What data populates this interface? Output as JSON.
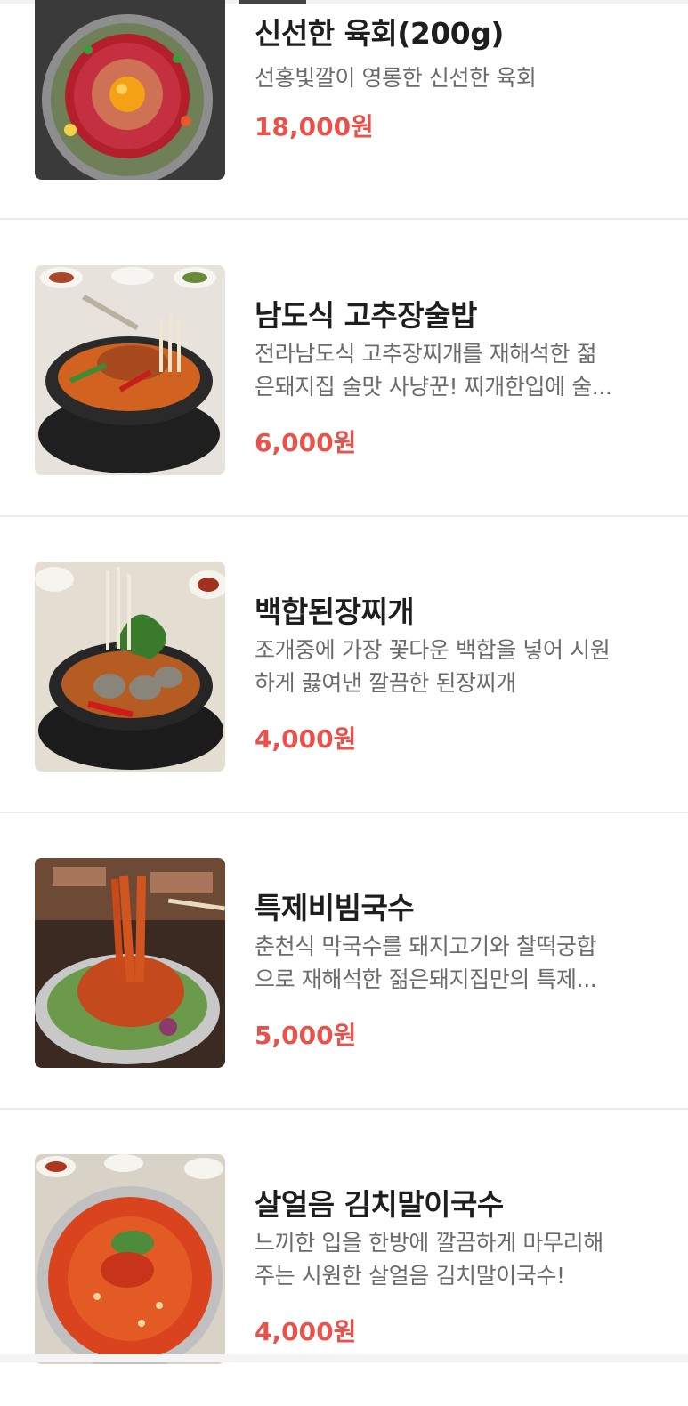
{
  "menu_items": [
    {
      "name": "신선한 육회(200g)",
      "desc_lines": [
        "선홍빛깔이 영롱한 신선한 육회"
      ],
      "price": "18,000원",
      "photo": "yukhoe-photo"
    },
    {
      "name": "남도식 고추장술밥",
      "desc_lines": [
        "전라남도식 고추장찌개를 재해석한 젊",
        "은돼지집 술맛 사냥꾼! 찌개한입에 술..."
      ],
      "price": "6,000원",
      "photo": "gochujang-stew-photo"
    },
    {
      "name": "백합된장찌개",
      "desc_lines": [
        "조개중에 가장 꽃다운 백합을 넣어 시원",
        "하게 끓여낸 깔끔한 된장찌개"
      ],
      "price": "4,000원",
      "photo": "clam-doenjang-stew-photo"
    },
    {
      "name": "특제비빔국수",
      "desc_lines": [
        "춘천식 막국수를 돼지고기와 찰떡궁합",
        "으로 재해석한 젊은돼지집만의 특제..."
      ],
      "price": "5,000원",
      "photo": "bibim-noodles-photo"
    },
    {
      "name": "살얼음 김치말이국수",
      "desc_lines": [
        "느끼한 입을 한방에 깔끔하게 마무리해",
        "주는 시원한 살얼음 김치말이국수!"
      ],
      "price": "4,000원",
      "photo": "kimchi-noodles-photo"
    }
  ],
  "colors": {
    "price": "#e8524a",
    "name": "#1e1e1e",
    "desc": "#6b6b6b",
    "divider": "#ebebeb"
  }
}
